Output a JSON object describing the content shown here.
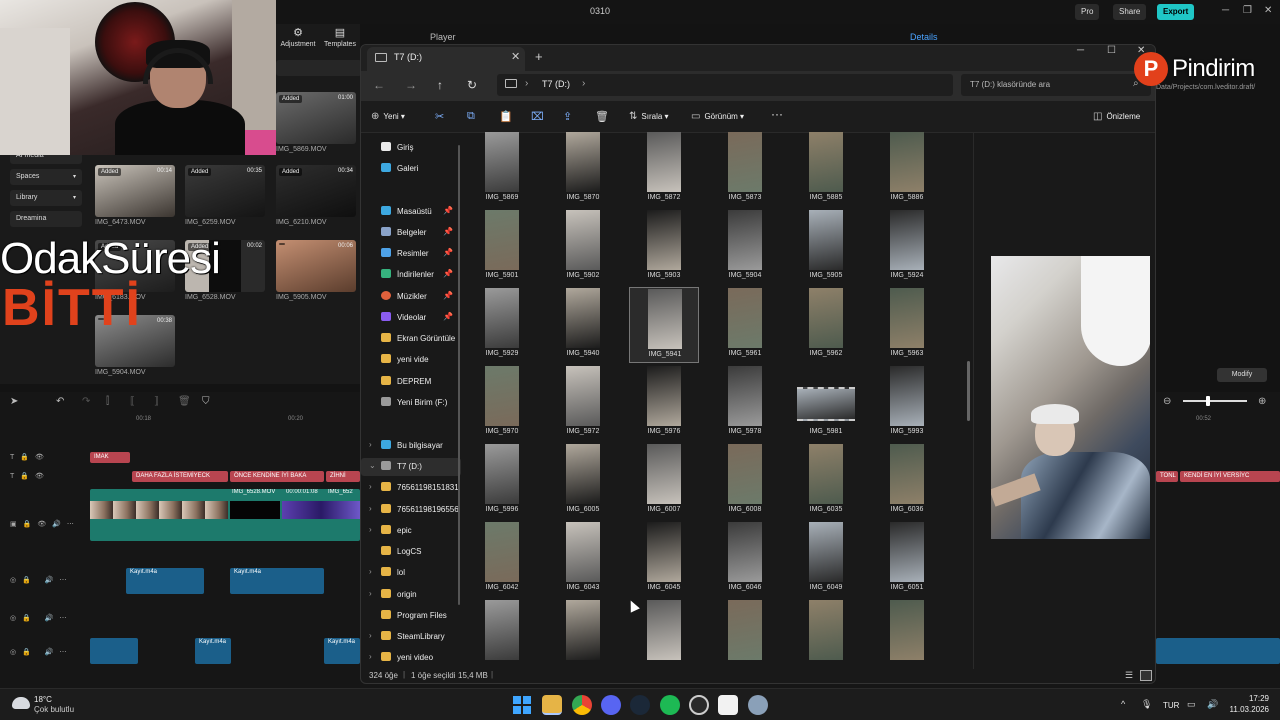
{
  "editor": {
    "title": "0310",
    "pro": "Pro",
    "share": "Share",
    "export": "Export",
    "tool_tabs": [
      "Adjustment",
      "Templates"
    ],
    "side_menu": [
      "AI media",
      "Spaces",
      "Library",
      "Dreamina"
    ],
    "player_label": "Player",
    "details_label": "Details",
    "modify": "Modify",
    "project_path": "Data/Projects/com.lveditor.draft/",
    "media": [
      {
        "tag": "Added",
        "dur": "01:00",
        "name": "IMG_5869.MOV"
      },
      {
        "tag": "Added",
        "dur": "00:14",
        "name": "IMG_6473.MOV"
      },
      {
        "tag": "Added",
        "dur": "00:35",
        "name": "IMG_6259.MOV"
      },
      {
        "tag": "Added",
        "dur": "00:34",
        "name": "IMG_6210.MOV"
      },
      {
        "tag": "Added",
        "dur": "",
        "name": "IMG_6183.MOV"
      },
      {
        "tag": "Added",
        "dur": "00:02",
        "name": "IMG_6528.MOV"
      },
      {
        "tag": "",
        "dur": "00:06",
        "name": "IMG_5905.MOV"
      },
      {
        "tag": "",
        "dur": "00:38",
        "name": "IMG_5904.MOV"
      }
    ],
    "ruler": [
      "00:18",
      "00:20",
      "00:52"
    ],
    "text_clips": [
      "IMAK",
      "DAHA FAZLA İSTEMİYECK",
      "ÖNCE KENDİNE İYİ BAKA",
      "ZİHNİ",
      "TONL",
      "KENDİ EN İYİ VERSİYC"
    ],
    "video_clip_label": "IMG_6528.MOV",
    "video_clip_time": "00:00:01:08",
    "video_clip_label2": "IMG_652",
    "audio_label": "Kayıt.m4a"
  },
  "overlay": {
    "odak": "OdakSüresi",
    "bitti": "BİTTİ",
    "watermark": "Pindirim",
    "watermark_logo": "P"
  },
  "explorer": {
    "tab_title": "T7 (D:)",
    "address": "T7 (D:)",
    "search_placeholder": "T7 (D:) klasöründe ara",
    "commands": {
      "new": "Yeni",
      "sort": "Sırala",
      "view": "Görünüm",
      "more": "···",
      "preview": "Önizleme"
    },
    "nav": [
      {
        "label": "Giriş",
        "color": "#e9e9e9",
        "pin": false
      },
      {
        "label": "Galeri",
        "color": "#3da8e0",
        "pin": false
      },
      {
        "label": "Masaüstü",
        "color": "#3da8e0",
        "pin": true
      },
      {
        "label": "Belgeler",
        "color": "#8aa3c9",
        "pin": true
      },
      {
        "label": "Resimler",
        "color": "#4ea2e8",
        "pin": true
      },
      {
        "label": "İndirilenler",
        "color": "#36b37e",
        "pin": true
      },
      {
        "label": "Müzikler",
        "color": "#e2613c",
        "pin": true
      },
      {
        "label": "Videolar",
        "color": "#8a5cf0",
        "pin": true
      },
      {
        "label": "Ekran Görüntüle",
        "color": "#e6b446",
        "pin": false
      },
      {
        "label": "yeni vide",
        "color": "#e6b446",
        "pin": false
      },
      {
        "label": "DEPREM",
        "color": "#e6b446",
        "pin": false
      },
      {
        "label": "Yeni Birim (F:)",
        "color": "#9a9a9a",
        "pin": false
      }
    ],
    "nav_tree": [
      {
        "label": "Bu bilgisayar",
        "color": "#3da8e0",
        "exp": "›"
      },
      {
        "label": "T7 (D:)",
        "color": "#9a9a9a",
        "exp": "⌄"
      },
      {
        "label": "76561198151831",
        "color": "#e6b446",
        "exp": "›"
      },
      {
        "label": "76561198196556",
        "color": "#e6b446",
        "exp": "›"
      },
      {
        "label": "epic",
        "color": "#e6b446",
        "exp": "›"
      },
      {
        "label": "LogCS",
        "color": "#e6b446",
        "exp": ""
      },
      {
        "label": "lol",
        "color": "#e6b446",
        "exp": "›"
      },
      {
        "label": "origin",
        "color": "#e6b446",
        "exp": "›"
      },
      {
        "label": "Program Files",
        "color": "#e6b446",
        "exp": ""
      },
      {
        "label": "SteamLibrary",
        "color": "#e6b446",
        "exp": "›"
      },
      {
        "label": "yeni video",
        "color": "#e6b446",
        "exp": "›"
      }
    ],
    "files": [
      "IMG_5869",
      "IMG_5870",
      "IMG_5872",
      "IMG_5873",
      "IMG_5885",
      "IMG_5886",
      "IMG_5901",
      "IMG_5902",
      "IMG_5903",
      "IMG_5904",
      "IMG_5905",
      "IMG_5924",
      "IMG_5929",
      "IMG_5940",
      "IMG_5941",
      "IMG_5961",
      "IMG_5962",
      "IMG_5963",
      "IMG_5970",
      "IMG_5972",
      "IMG_5976",
      "IMG_5978",
      "IMG_5981",
      "IMG_5993",
      "IMG_5996",
      "IMG_6005",
      "IMG_6007",
      "IMG_6008",
      "IMG_6035",
      "IMG_6036",
      "IMG_6042",
      "IMG_6043",
      "IMG_6045",
      "IMG_6046",
      "IMG_6049",
      "IMG_6051",
      "",
      "",
      "",
      "",
      "",
      ""
    ],
    "selected_file": "IMG_5941",
    "status": {
      "count": "324 öğe",
      "selected": "1 öğe seçildi",
      "size": "15,4 MB"
    }
  },
  "taskbar": {
    "temp": "18°C",
    "weather": "Çok bulutlu",
    "lang": "TUR",
    "time": "17:29",
    "date": "11.03.2026"
  }
}
